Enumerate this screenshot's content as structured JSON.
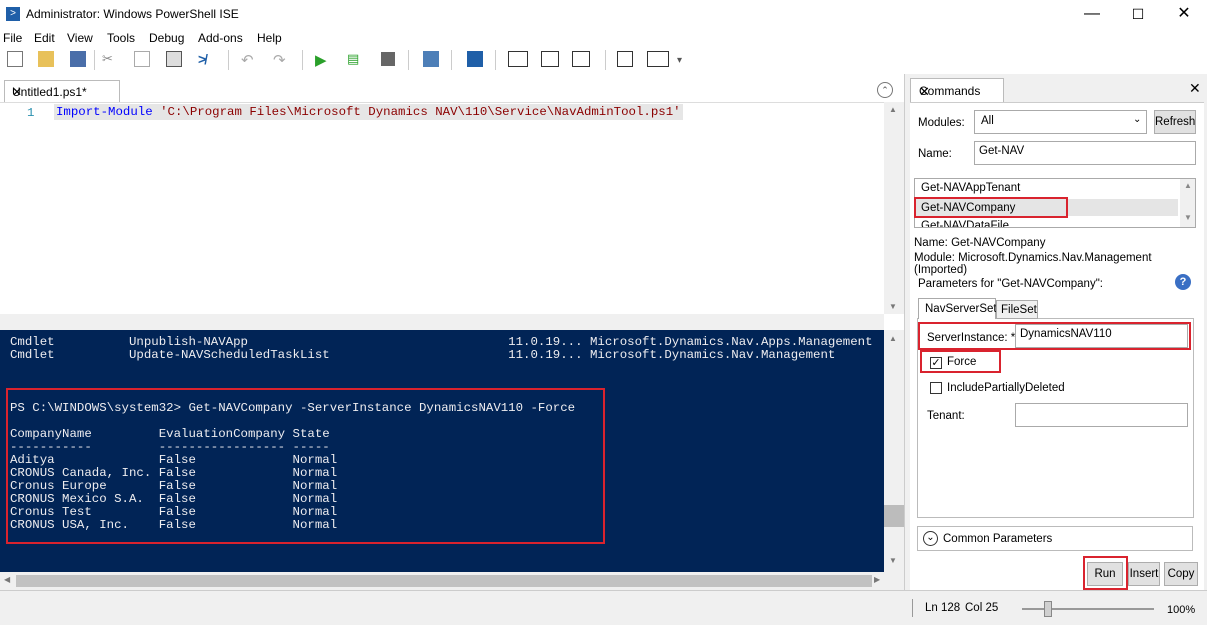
{
  "window": {
    "title": "Administrator: Windows PowerShell ISE",
    "minimize": "—",
    "maximize": "☐",
    "close": "✕"
  },
  "menu": [
    "File",
    "Edit",
    "View",
    "Tools",
    "Debug",
    "Add-ons",
    "Help"
  ],
  "editor": {
    "tab_label": "Untitled1.ps1*",
    "tab_close": "✕",
    "line_number": "1",
    "code_keyword": "Import-Module",
    "code_string": "'C:\\Program Files\\Microsoft Dynamics NAV\\110\\Service\\NavAdminTool.ps1'"
  },
  "console": {
    "lines": [
      "Cmdlet          Unpublish-NAVApp                                   11.0.19... Microsoft.Dynamics.Nav.Apps.Management",
      "Cmdlet          Update-NAVScheduledTaskList                        11.0.19... Microsoft.Dynamics.Nav.Management",
      "PS C:\\WINDOWS\\system32> Get-NAVCompany -ServerInstance DynamicsNAV110 -Force",
      "CompanyName         EvaluationCompany State",
      "-----------         ----------------- -----",
      "Aditya              False             Normal",
      "CRONUS Canada, Inc. False             Normal",
      "Cronus Europe       False             Normal",
      "CRONUS Mexico S.A.  False             Normal",
      "Cronus Test         False             Normal",
      "CRONUS USA, Inc.    False             Normal"
    ]
  },
  "commands": {
    "tab_label": "Commands",
    "tab_close": "✕",
    "pane_close": "✕",
    "modules_label": "Modules:",
    "modules_value": "All",
    "refresh_label": "Refresh",
    "name_label": "Name:",
    "name_value": "Get-NAV",
    "list": [
      "Get-NAVAppTenant",
      "Get-NAVCompany",
      "Get-NAVDataFile"
    ],
    "info_name": "Name: Get-NAVCompany",
    "info_module": "Module: Microsoft.Dynamics.Nav.Management (Imported)",
    "params_label": "Parameters for \"Get-NAVCompany\":",
    "help": "?",
    "param_tabs": [
      "NavServerSet",
      "FileSet"
    ],
    "server_instance_label": "ServerInstance: *",
    "server_instance_value": "DynamicsNAV110",
    "force_label": "Force",
    "force_check": "✓",
    "include_deleted_label": "IncludePartiallyDeleted",
    "tenant_label": "Tenant:",
    "tenant_value": "",
    "common_params_label": "Common Parameters",
    "expand_glyph": "⌄",
    "run_label": "Run",
    "insert_label": "Insert",
    "copy_label": "Copy"
  },
  "status": {
    "line": "Ln 128",
    "col": "Col 25",
    "zoom": "100%",
    "zoom_fraction": 0.2
  },
  "colors": {
    "console_bg": "#012456",
    "highlight_red": "#d9232e",
    "keyword": "#0000ff",
    "string": "#8b0000"
  }
}
